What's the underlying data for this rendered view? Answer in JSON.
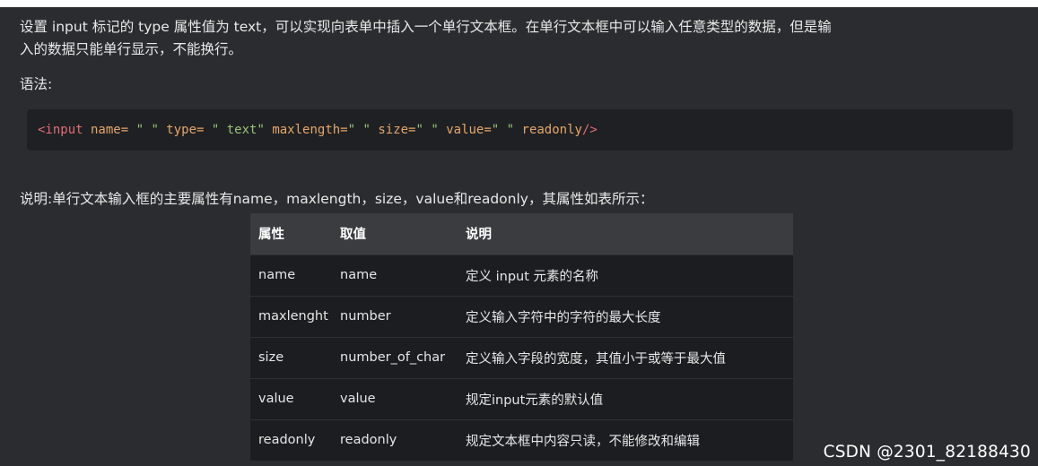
{
  "intro": {
    "line1": "设置 input 标记的 type 属性值为 text，可以实现向表单中插入一个单行文本框。在单行文本框中可以输入任意类型的数据，但是输",
    "line2": "入的数据只能单行显示，不能换行。"
  },
  "syntax_label": "语法:",
  "code": {
    "tag_open": "<input",
    "attr_name": " name=",
    "val_name": " \" \"",
    "attr_type": " type=",
    "val_type": " \" text\"",
    "attr_maxlength": " maxlength=",
    "val_maxlength": "\" \"",
    "attr_size": " size=",
    "val_size": "\" \"",
    "attr_value": " value=",
    "val_value": "\" \"",
    "attr_readonly": " readonly",
    "tag_close": "/>"
  },
  "description": "说明:单行文本输入框的主要属性有name，maxlength，size，value和readonly，其属性如表所示：",
  "table": {
    "headers": [
      "属性",
      "取值",
      "说明"
    ],
    "rows": [
      [
        "name",
        "name",
        "定义 input 元素的名称"
      ],
      [
        "maxlenght",
        "number",
        "定义输入字符中的字符的最大长度"
      ],
      [
        "size",
        "number_of_char",
        "定义输入字段的宽度，其值小于或等于最大值"
      ],
      [
        "value",
        "value",
        "规定input元素的默认值"
      ],
      [
        "readonly",
        " readonly",
        "规定文本框中内容只读，不能修改和编辑"
      ]
    ]
  },
  "watermark": "CSDN @2301_82188430"
}
